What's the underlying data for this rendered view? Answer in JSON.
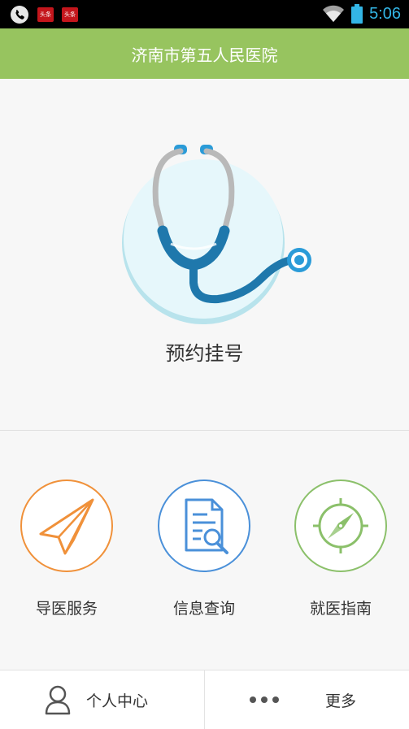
{
  "status_bar": {
    "time": "5:06",
    "icons": [
      "phone-icon",
      "news-app-icon",
      "news-app-icon",
      "wifi-icon",
      "battery-icon"
    ],
    "news_icon_text": "头条"
  },
  "header": {
    "title": "济南市第五人民医院"
  },
  "main": {
    "appointment_label": "预约挂号",
    "appointment_icon": "stethoscope-icon"
  },
  "services": [
    {
      "label": "导医服务",
      "icon": "paper-plane-icon",
      "color": "#f0913a"
    },
    {
      "label": "信息查询",
      "icon": "document-search-icon",
      "color": "#4a90d9"
    },
    {
      "label": "就医指南",
      "icon": "compass-icon",
      "color": "#8bc06a"
    }
  ],
  "tabbar": {
    "personal_label": "个人中心",
    "more_label": "更多"
  },
  "colors": {
    "header_bg": "#97c45f",
    "accent_blue": "#2a9bd8",
    "time": "#33b5e5"
  }
}
